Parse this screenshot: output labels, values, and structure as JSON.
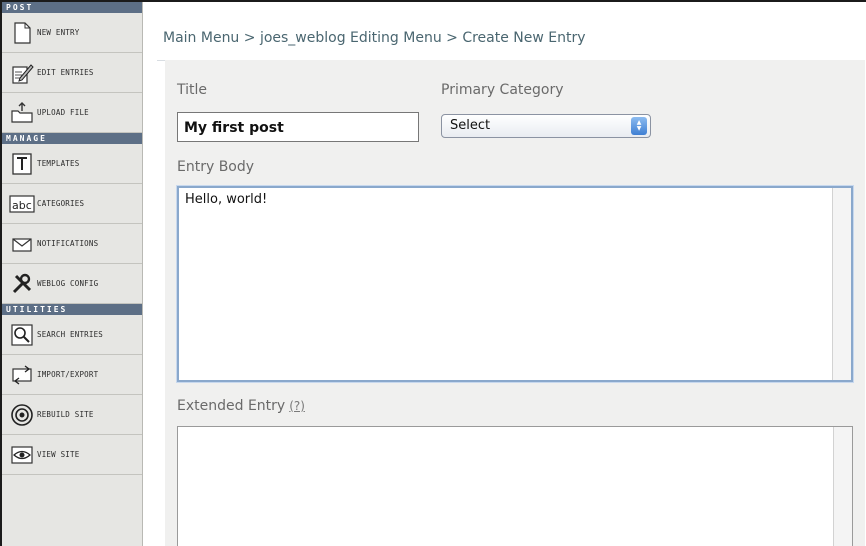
{
  "sidebar": {
    "sections": [
      {
        "title": "POST",
        "items": [
          {
            "label": "NEW ENTRY",
            "icon": "new-entry-icon"
          },
          {
            "label": "EDIT ENTRIES",
            "icon": "edit-entries-icon"
          },
          {
            "label": "UPLOAD FILE",
            "icon": "upload-file-icon"
          }
        ]
      },
      {
        "title": "MANAGE",
        "items": [
          {
            "label": "TEMPLATES",
            "icon": "templates-icon"
          },
          {
            "label": "CATEGORIES",
            "icon": "categories-icon"
          },
          {
            "label": "NOTIFICATIONS",
            "icon": "notifications-icon"
          },
          {
            "label": "WEBLOG CONFIG",
            "icon": "weblog-config-icon"
          }
        ]
      },
      {
        "title": "UTILITIES",
        "items": [
          {
            "label": "SEARCH ENTRIES",
            "icon": "search-entries-icon"
          },
          {
            "label": "IMPORT/EXPORT",
            "icon": "import-export-icon"
          },
          {
            "label": "REBUILD SITE",
            "icon": "rebuild-site-icon"
          },
          {
            "label": "VIEW SITE",
            "icon": "view-site-icon"
          }
        ]
      }
    ]
  },
  "breadcrumb": "Main Menu > joes_weblog Editing Menu > Create New Entry",
  "form": {
    "title_label": "Title",
    "title_value": "My first post",
    "category_label": "Primary Category",
    "category_value": "Select",
    "body_label": "Entry Body",
    "body_value": "Hello, world!",
    "extended_label": "Extended Entry",
    "extended_help": "(?)",
    "extended_value": ""
  },
  "colors": {
    "section_header": "#5d6f86",
    "breadcrumb_text": "#4a6670",
    "select_arrow": "#3f7fd3",
    "focus_border": "#8aa8cc"
  }
}
